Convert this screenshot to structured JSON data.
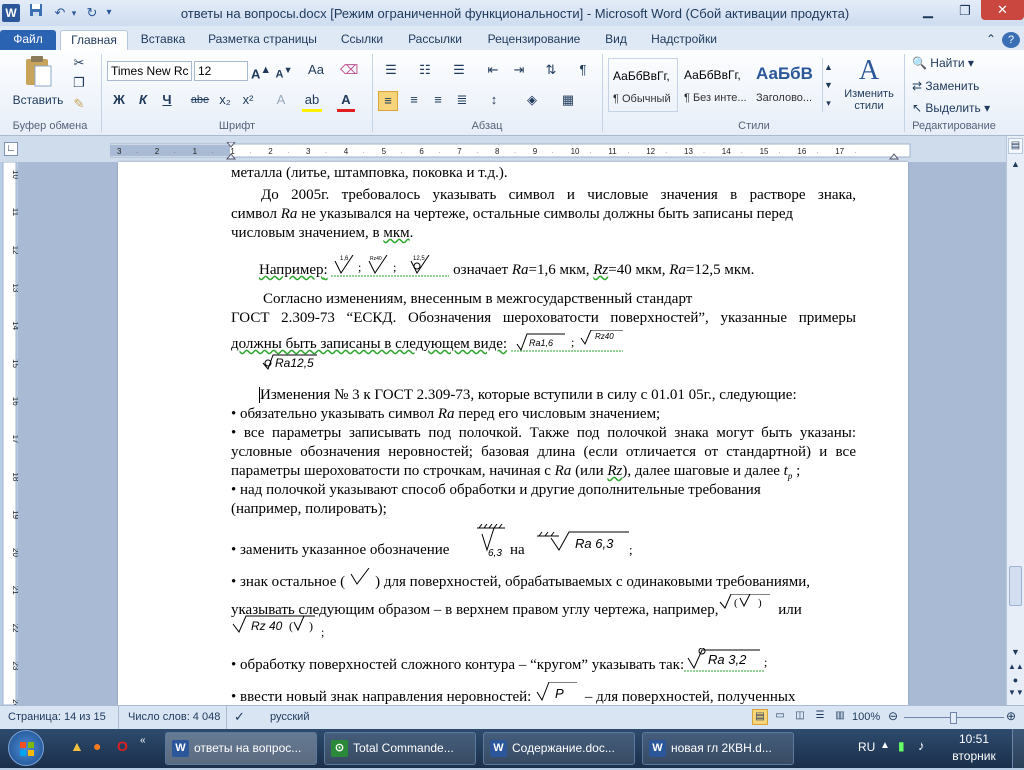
{
  "window": {
    "title": "ответы на вопросы.docx [Режим ограниченной функциональности] - Microsoft Word (Сбой активации продукта)"
  },
  "qat": {
    "word_icon": "W",
    "save_icon": "save-icon",
    "undo_icon": "↶",
    "redo_icon": "↻",
    "customize_icon": "▾"
  },
  "tabs": [
    "Файл",
    "Главная",
    "Вставка",
    "Разметка страницы",
    "Ссылки",
    "Рассылки",
    "Рецензирование",
    "Вид",
    "Надстройки"
  ],
  "ribbon": {
    "clipboard": {
      "label": "Буфер обмена",
      "paste": "Вставить"
    },
    "font": {
      "label": "Шрифт",
      "name": "Times New Rc",
      "size": "12",
      "buttons": [
        "Ж",
        "К",
        "Ч",
        "abe",
        "x₂",
        "x²"
      ],
      "aa": "Aa"
    },
    "paragraph": {
      "label": "Абзац"
    },
    "styles": {
      "label": "Стили",
      "items": [
        {
          "sample": "АаБбВвГг,",
          "name": "¶ Обычный"
        },
        {
          "sample": "АаБбВвГг,",
          "name": "¶ Без инте..."
        },
        {
          "sample": "АаБбВ",
          "name": "Заголово..."
        }
      ],
      "change": "Изменить стили"
    },
    "editing": {
      "label": "Редактирование",
      "find": "Найти",
      "replace": "Заменить",
      "select": "Выделить"
    }
  },
  "ruler": {
    "numbers": [
      "3",
      "2",
      "1",
      "1",
      "2",
      "3",
      "4",
      "5",
      "6",
      "7",
      "8",
      "9",
      "10",
      "11",
      "12",
      "13",
      "14",
      "15",
      "16",
      "17"
    ],
    "vnumbers": [
      "10",
      "11",
      "12",
      "13",
      "14",
      "15",
      "16",
      "17",
      "18",
      "19",
      "20",
      "21",
      "22",
      "23",
      "24",
      "25",
      "26"
    ]
  },
  "document": {
    "l1": "металла (литье, штамповка, поковка и т.д.).",
    "l2": "До 2005г. требовалось указывать символ и числовые значения в растворе знака,",
    "l3a": "символ ",
    "l3b": "Ra",
    "l3c": " не указывался на чертеже, остальные символы должны быть записаны перед",
    "l4a": "числовым значением, в ",
    "l4b": "мкм",
    "l5a": "Например",
    "l5b": "означает ",
    "l5c": "Ra",
    "l5d": "=1,6 мкм, ",
    "l5e": "Rz",
    "l5f": "=40 мкм, ",
    "l5g": "Ra",
    "l5h": "=12,5 мкм.",
    "sym_ex": [
      "1,6",
      "Rz40",
      "12,5"
    ],
    "l6": "Согласно изменениям, внесенным в межгосударственный стандарт",
    "l7": "ГОСТ 2.309-73 “ЕСКД. Обозначения шероховатости поверхностей”, указанные примеры",
    "l8": "должны быть записаны в следующем виде:",
    "sym_new": [
      "Ra1,6",
      "Rz40",
      "Ra12,5"
    ],
    "l9": "Изменения № 3 к ГОСТ 2.309-73, которые вступили в силу с 01.01 05г., следующие:",
    "l10a": "• обязательно указывать символ ",
    "l10b": "Ra",
    "l10c": " перед его числовым значением;",
    "l11": "• все параметры записывать под полочкой. Также под полочкой знака могут быть указаны:",
    "l12": "условные обозначения неровностей; базовая длина (если отличается от стандартной) и все",
    "l13a": "параметры шероховатости по строчкам, начиная с ",
    "l13b": "Ra",
    "l13c": " (или ",
    "l13d": "Rz",
    "l13e": "), далее шаговые и далее ",
    "l13f": "t",
    "l13g": "p",
    "l14": "•  над полочкой указывают способ обработки и другие дополнительные требования",
    "l15": "(например, полировать);",
    "l16a": "• заменить указанное обозначение",
    "l16b": "на",
    "sym16": [
      "6,3",
      "Ra 6,3"
    ],
    "l17a": "• знак остальное (",
    "l17b": ") для поверхностей, обрабатываемых с одинаковыми требованиями,",
    "l18a": "указывать следующим образом – в верхнем правом углу чертежа, например,",
    "l18b": "или",
    "sym18": [
      "Rz 40"
    ],
    "l19": "• обработку поверхностей сложного контура – “кругом” указывать так:",
    "sym19": "Ra 3,2",
    "l20a": "• ввести новый знак направления неровностей:",
    "sym20": "P",
    "l20b": "– для поверхностей, полученных"
  },
  "status": {
    "page": "Страница: 14 из 15",
    "words": "Число слов: 4 048",
    "lang": "русский",
    "zoom": "100%"
  },
  "taskbar": {
    "tasks": [
      "ответы на вопрос...",
      "Total Commande...",
      "Содержание.doc...",
      "новая гл 2КВН.d..."
    ],
    "lang": "RU",
    "time": "10:51",
    "day": "вторник"
  }
}
